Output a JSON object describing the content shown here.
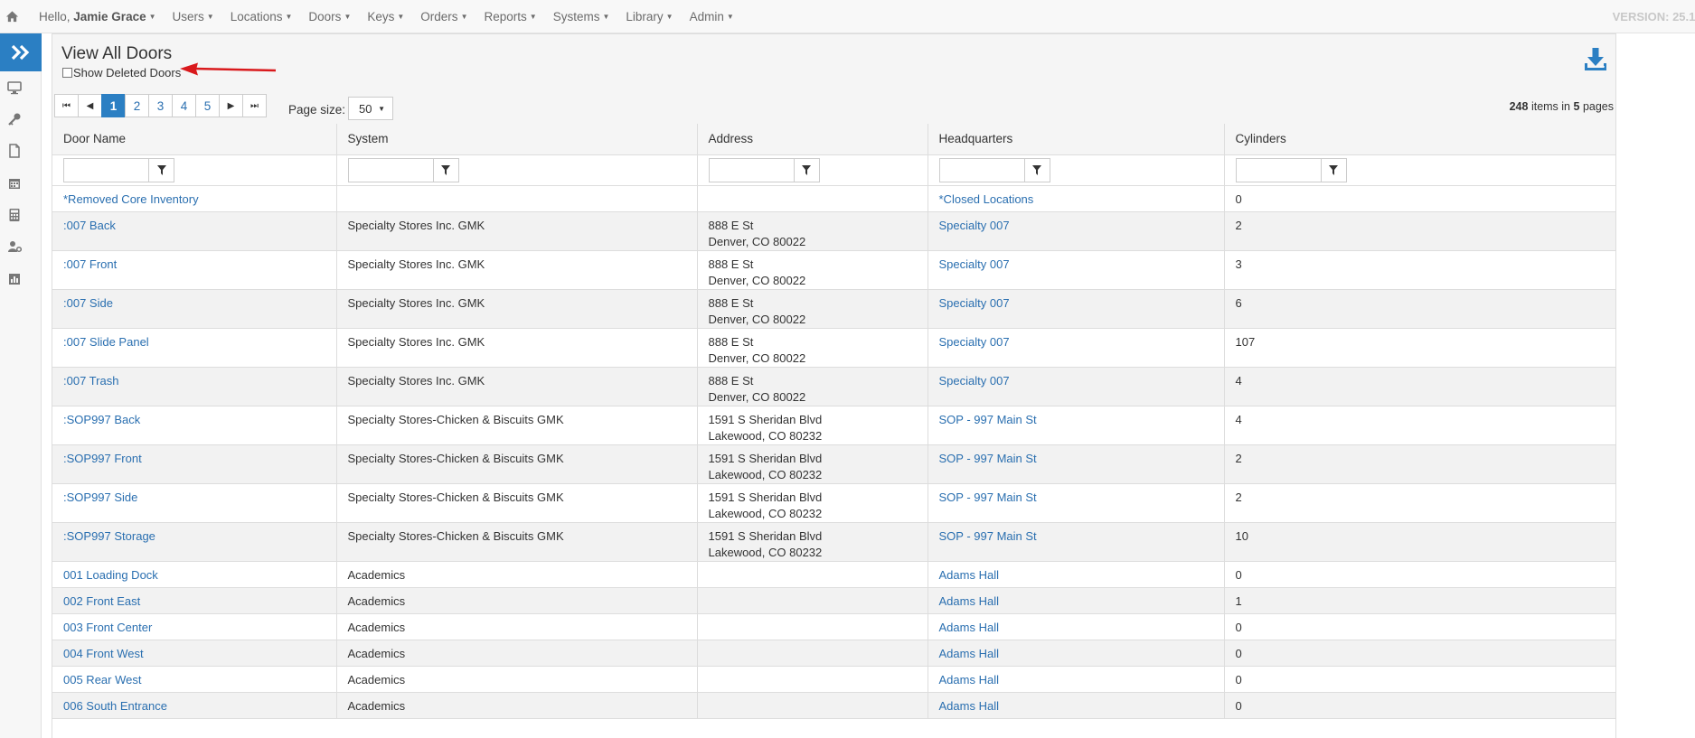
{
  "nav": {
    "greeting": "Hello,",
    "user": "Jamie Grace",
    "items": [
      "Users",
      "Locations",
      "Doors",
      "Keys",
      "Orders",
      "Reports",
      "Systems",
      "Library",
      "Admin"
    ],
    "version": "VERSION: 25.1."
  },
  "page": {
    "title": "View All Doors",
    "show_deleted_label": "Show Deleted Doors"
  },
  "pager": {
    "pages": [
      "1",
      "2",
      "3",
      "4",
      "5"
    ],
    "active_page": "1",
    "page_size_label": "Page size:",
    "page_size": "50",
    "total_items": "248",
    "items_in_text": "items in",
    "total_pages": "5",
    "pages_text": "pages"
  },
  "table": {
    "columns": [
      "Door Name",
      "System",
      "Address",
      "Headquarters",
      "Cylinders"
    ],
    "rows": [
      {
        "name": "*Removed Core Inventory",
        "system": "",
        "addr1": "",
        "addr2": "",
        "hq": "*Closed Locations",
        "cyl": "0"
      },
      {
        "name": ":007 Back",
        "system": "Specialty Stores Inc. GMK",
        "addr1": "888 E St",
        "addr2": "Denver, CO 80022",
        "hq": "Specialty 007",
        "cyl": "2"
      },
      {
        "name": ":007 Front",
        "system": "Specialty Stores Inc. GMK",
        "addr1": "888 E St",
        "addr2": "Denver, CO 80022",
        "hq": "Specialty 007",
        "cyl": "3"
      },
      {
        "name": ":007 Side",
        "system": "Specialty Stores Inc. GMK",
        "addr1": "888 E St",
        "addr2": "Denver, CO 80022",
        "hq": "Specialty 007",
        "cyl": "6"
      },
      {
        "name": ":007 Slide Panel",
        "system": "Specialty Stores Inc. GMK",
        "addr1": "888 E St",
        "addr2": "Denver, CO 80022",
        "hq": "Specialty 007",
        "cyl": "107"
      },
      {
        "name": ":007 Trash",
        "system": "Specialty Stores Inc. GMK",
        "addr1": "888 E St",
        "addr2": "Denver, CO 80022",
        "hq": "Specialty 007",
        "cyl": "4"
      },
      {
        "name": ":SOP997 Back",
        "system": "Specialty Stores-Chicken & Biscuits GMK",
        "addr1": "1591 S Sheridan Blvd",
        "addr2": "Lakewood, CO 80232",
        "hq": "SOP - 997 Main St",
        "cyl": "4"
      },
      {
        "name": ":SOP997 Front",
        "system": "Specialty Stores-Chicken & Biscuits GMK",
        "addr1": "1591 S Sheridan Blvd",
        "addr2": "Lakewood, CO 80232",
        "hq": "SOP - 997 Main St",
        "cyl": "2"
      },
      {
        "name": ":SOP997 Side",
        "system": "Specialty Stores-Chicken & Biscuits GMK",
        "addr1": "1591 S Sheridan Blvd",
        "addr2": "Lakewood, CO 80232",
        "hq": "SOP - 997 Main St",
        "cyl": "2"
      },
      {
        "name": ":SOP997 Storage",
        "system": "Specialty Stores-Chicken & Biscuits GMK",
        "addr1": "1591 S Sheridan Blvd",
        "addr2": "Lakewood, CO 80232",
        "hq": "SOP - 997 Main St",
        "cyl": "10"
      },
      {
        "name": "001 Loading Dock",
        "system": "Academics",
        "addr1": "",
        "addr2": "",
        "hq": "Adams Hall",
        "cyl": "0"
      },
      {
        "name": "002 Front East",
        "system": "Academics",
        "addr1": "",
        "addr2": "",
        "hq": "Adams Hall",
        "cyl": "1"
      },
      {
        "name": "003 Front Center",
        "system": "Academics",
        "addr1": "",
        "addr2": "",
        "hq": "Adams Hall",
        "cyl": "0"
      },
      {
        "name": "004 Front West",
        "system": "Academics",
        "addr1": "",
        "addr2": "",
        "hq": "Adams Hall",
        "cyl": "0"
      },
      {
        "name": "005 Rear West",
        "system": "Academics",
        "addr1": "",
        "addr2": "",
        "hq": "Adams Hall",
        "cyl": "0"
      },
      {
        "name": "006 South Entrance",
        "system": "Academics",
        "addr1": "",
        "addr2": "",
        "hq": "Adams Hall",
        "cyl": "0"
      }
    ]
  },
  "colors": {
    "accent": "#2b7fc3",
    "link": "#2a6fb0",
    "annotation_arrow": "#d9191c"
  },
  "icons": {
    "home": "home-icon",
    "sidebar_toggle": "double-chevron-right-icon",
    "sidebar": [
      "monitor-icon",
      "key-icon",
      "document-icon",
      "calendar-icon",
      "calculator-icon",
      "user-gear-icon",
      "bar-chart-icon"
    ],
    "download": "download-icon",
    "filter": "filter-icon"
  }
}
